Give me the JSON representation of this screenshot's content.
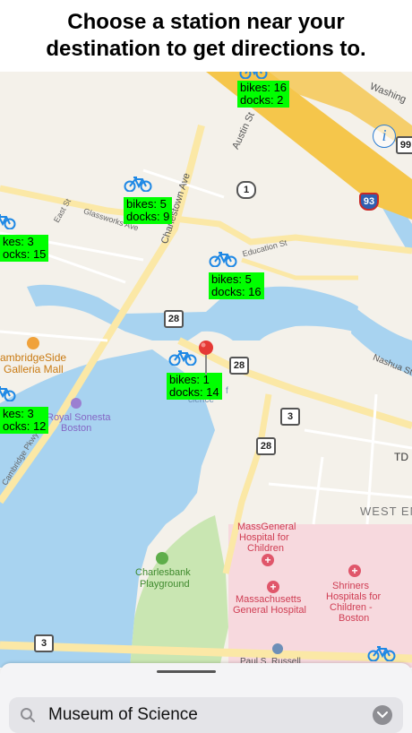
{
  "header": {
    "title": "Choose a station near your destination to get directions to."
  },
  "map": {
    "labels": {
      "charlestown_ave": "Charlestown Ave",
      "east_st": "East St",
      "glassworks_ave": "Glassworks Ave",
      "austin_st": "Austin St",
      "education_st": "Education St",
      "washington": "Washing",
      "cambridgeside_1": "ambridgeSide",
      "cambridgeside_2": "Galleria Mall",
      "royal_sonesta_1": "Royal Sonesta",
      "royal_sonesta_2": "Boston",
      "cambridge_pkwy": "Cambridge Pkwy",
      "nashua_st": "Nashua St",
      "td": "TD",
      "west_end": "WEST EN",
      "mgh_children_1": "MassGeneral",
      "mgh_children_2": "Hospital for",
      "mgh_children_3": "Children",
      "mgh_1": "Massachusetts",
      "mgh_2": "General Hospital",
      "shriners_1": "Shriners",
      "shriners_2": "Hospitals for",
      "shriners_3": "Children -",
      "shriners_4": "Boston",
      "charlesbank_1": "Charlesbank",
      "charlesbank_2": "Playground",
      "paul_russell": "Paul S. Russell",
      "science_frag_1": "f",
      "science_frag_2": "cience"
    },
    "shields": {
      "rt28_a": "28",
      "rt28_b": "28",
      "rt28_c": "28",
      "rt3_a": "3",
      "rt3_b": "3",
      "rt1": "1",
      "i93": "93",
      "rt99": "99"
    },
    "stations": [
      {
        "bikes": "bikes: 16",
        "docks": "docks: 2"
      },
      {
        "bikes": "bikes: 5",
        "docks": "docks: 9"
      },
      {
        "bikes": "kes: 3",
        "docks": "ocks: 15"
      },
      {
        "bikes": "bikes: 5",
        "docks": "docks: 16"
      },
      {
        "bikes": "bikes: 1",
        "docks": "docks: 14"
      },
      {
        "bikes": "kes: 3",
        "docks": "ocks: 12"
      }
    ],
    "colors": {
      "water": "#a8d3f0",
      "land": "#f4f1ea",
      "park": "#c9e6b2",
      "hospital": "#f7d9de",
      "highway": "#f5c64b",
      "station_label_bg": "#00ff00",
      "bike_icon": "#1e88e5",
      "pin": "#e53935"
    }
  },
  "search": {
    "value": "Museum of Science"
  }
}
